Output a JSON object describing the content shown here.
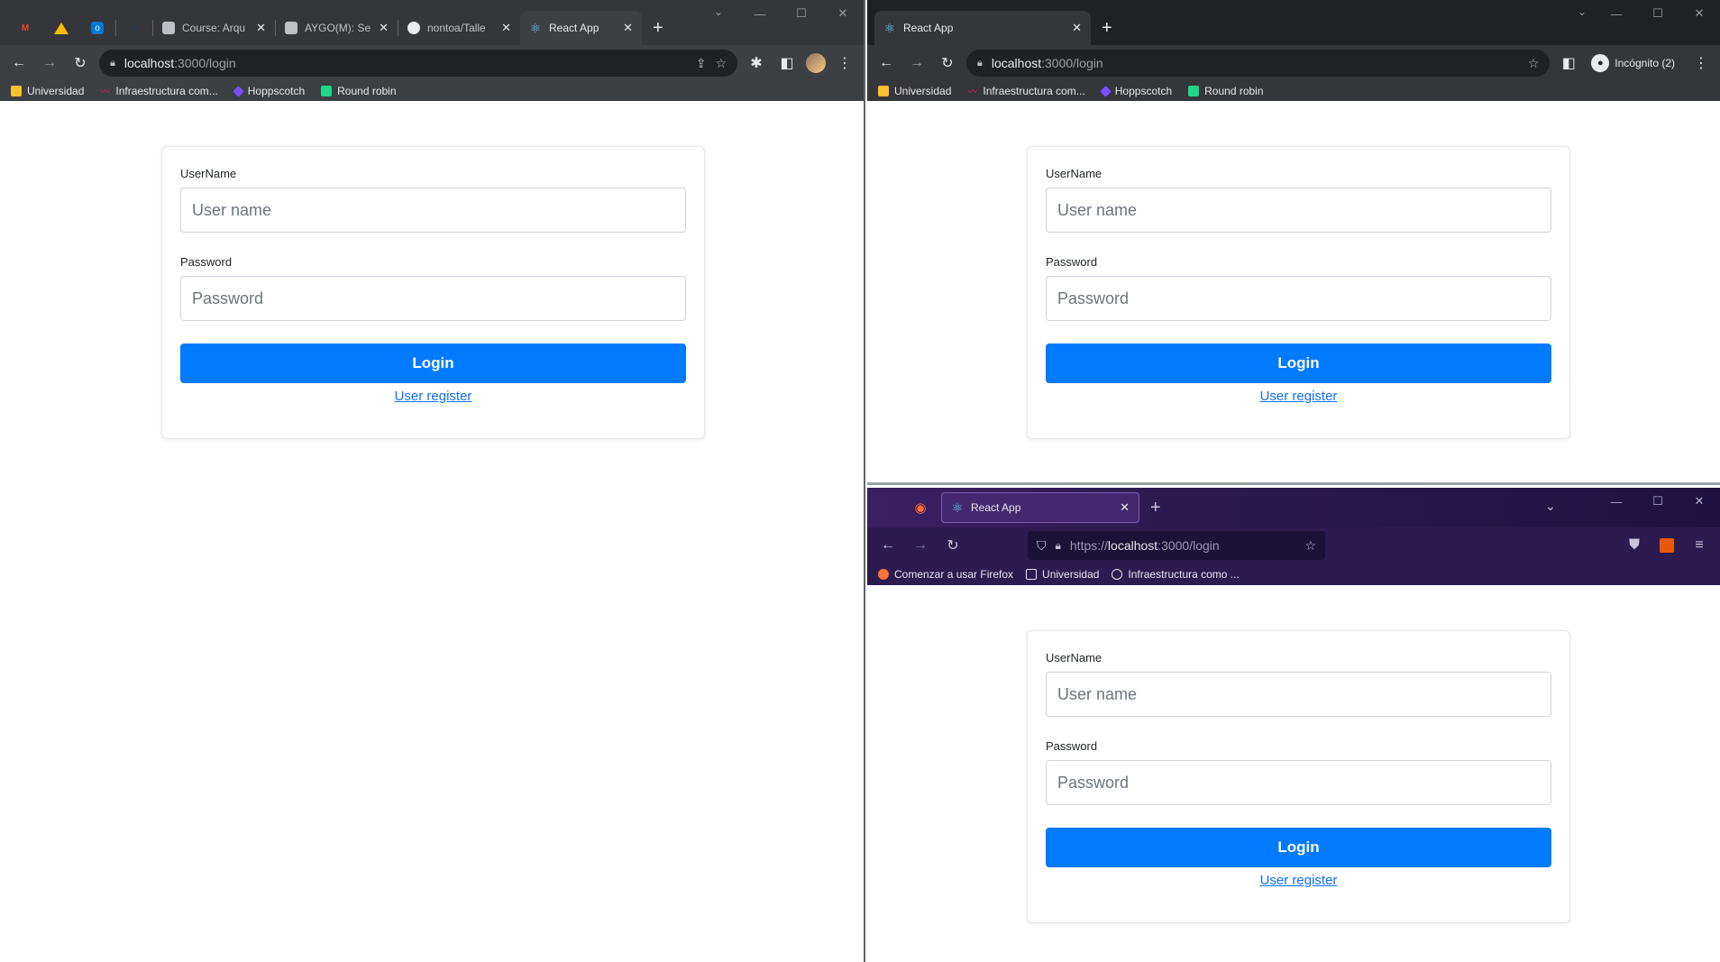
{
  "left": {
    "tabs": [
      {
        "title": "",
        "fav": "gmail-icon",
        "pinned": true
      },
      {
        "title": "",
        "fav": "drive-icon",
        "pinned": true
      },
      {
        "title": "",
        "fav": "outlook-icon",
        "pinned": true
      },
      {
        "title": "",
        "fav": "react-icon",
        "pinned": true
      },
      {
        "title": "Course: Arqu",
        "fav": "moodle-icon"
      },
      {
        "title": "AYGO(M): Se",
        "fav": "moodle-icon"
      },
      {
        "title": "nontoa/Talle",
        "fav": "github-icon"
      },
      {
        "title": "React App",
        "fav": "react-icon",
        "active": true
      }
    ],
    "address": {
      "host": "localhost",
      "path": ":3000/login"
    },
    "bookmarks": [
      "Universidad",
      "Infraestructura com...",
      "Hoppscotch",
      "Round robin"
    ]
  },
  "right_top": {
    "tab_title": "React App",
    "address": {
      "host": "localhost",
      "path": ":3000/login"
    },
    "incognito_label": "Incógnito (2)",
    "bookmarks": [
      "Universidad",
      "Infraestructura com...",
      "Hoppscotch",
      "Round robin"
    ]
  },
  "right_bottom": {
    "tab_title": "React App",
    "address": {
      "scheme": "https://",
      "host": "localhost",
      "path": ":3000/login"
    },
    "bookmarks": [
      "Comenzar a usar Firefox",
      "Universidad",
      "Infraestructura como ..."
    ]
  },
  "form": {
    "username_label": "UserName",
    "username_placeholder": "User name",
    "password_label": "Password",
    "password_placeholder": "Password",
    "login_label": "Login",
    "register_label": "User register"
  },
  "colors": {
    "primary": "#007bff",
    "link": "#0d6efd",
    "chrome_dark": "#35363a",
    "firefox_purple": "#2b1b4f"
  }
}
